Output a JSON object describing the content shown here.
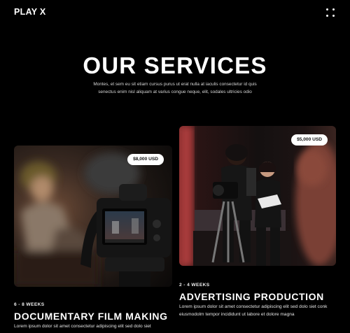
{
  "header": {
    "brand": "PLAY X",
    "menu_icon": "grid-dots-icon"
  },
  "hero": {
    "title": "OUR SERVICES",
    "description": "Montes, et sem eu sit etiam cursus purus ut erat nulla at iaculis consectetur id quis senectus enim nisl aliquam at varius congue neque, elit, sodales ultricies odio"
  },
  "services": [
    {
      "price": "$8,000 USD",
      "duration": "6 - 8 WEEKS",
      "title": "DOCUMENTARY FILM MAKING",
      "description": "Lorem ipsum dolor sit amet consectetur adipiscing elit sed dolo siet",
      "image_icon": "camera-interview-photo"
    },
    {
      "price": "$5,000 USD",
      "duration": "2 - 4 WEEKS",
      "title": "ADVERTISING PRODUCTION",
      "description": "Lorem ipsum dolor sit amet consectetur adipiscing elit sed dolo siet conk eiusmodolm tempor incididunt ut labore et dolore magna",
      "image_icon": "film-crew-photo"
    }
  ],
  "colors": {
    "background": "#000000",
    "text": "#ffffff",
    "price_badge": "#ffffff"
  }
}
